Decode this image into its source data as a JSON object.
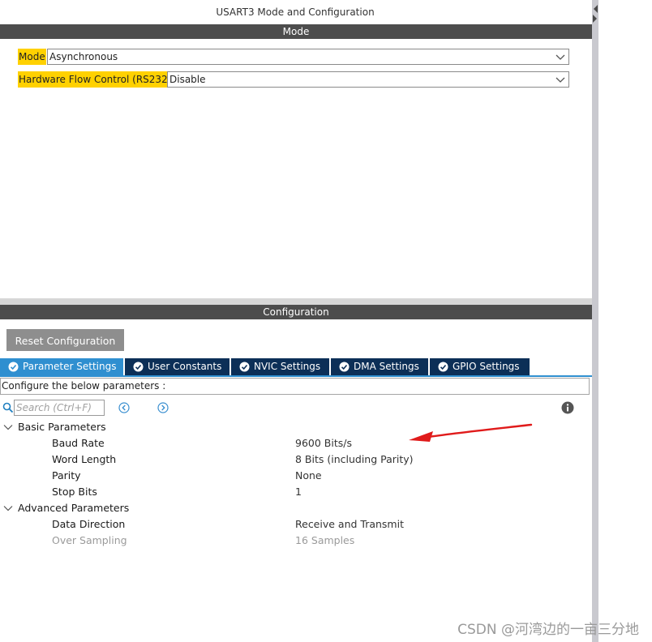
{
  "window": {
    "title": "USART3 Mode and Configuration"
  },
  "mode_section": {
    "header": "Mode",
    "fields": [
      {
        "label": "Mode",
        "value": "Asynchronous"
      },
      {
        "label": "Hardware Flow Control (RS232)",
        "value": "Disable"
      }
    ]
  },
  "config_section": {
    "header": "Configuration",
    "reset_label": "Reset Configuration",
    "tabs": [
      {
        "label": "Parameter Settings",
        "active": true
      },
      {
        "label": "User Constants",
        "active": false
      },
      {
        "label": "NVIC Settings",
        "active": false
      },
      {
        "label": "DMA Settings",
        "active": false
      },
      {
        "label": "GPIO Settings",
        "active": false
      }
    ],
    "configure_text": "Configure the below parameters :",
    "search": {
      "placeholder": "Search (Ctrl+F)"
    },
    "groups": [
      {
        "name": "Basic Parameters",
        "params": [
          {
            "name": "Baud Rate",
            "value": "9600 Bits/s"
          },
          {
            "name": "Word Length",
            "value": "8 Bits (including Parity)"
          },
          {
            "name": "Parity",
            "value": "None"
          },
          {
            "name": "Stop Bits",
            "value": "1"
          }
        ]
      },
      {
        "name": "Advanced Parameters",
        "params": [
          {
            "name": "Data Direction",
            "value": "Receive and Transmit"
          },
          {
            "name": "Over Sampling",
            "value": "16 Samples",
            "disabled": true
          }
        ]
      }
    ]
  },
  "watermark": "CSDN @河湾边的一亩三分地",
  "colors": {
    "header_bg": "#4d4d4d",
    "label_highlight": "#ffd100",
    "tab_bg": "#0c2f57",
    "tab_active_bg": "#2f8fd0",
    "annotation_arrow": "#e01b1b"
  },
  "icons": [
    "chevron-down-icon",
    "check-circle-icon",
    "search-icon",
    "arrow-left-circle-icon",
    "arrow-right-circle-icon",
    "info-icon",
    "chevron-expanded-icon"
  ]
}
